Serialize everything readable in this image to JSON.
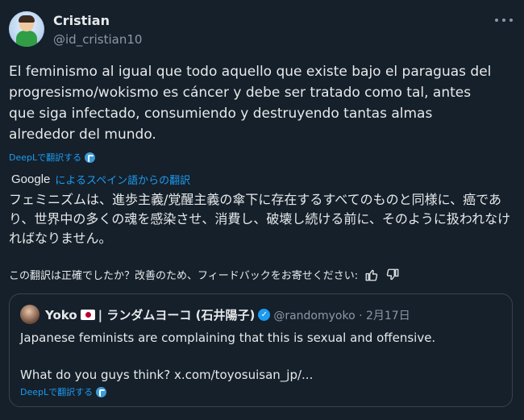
{
  "author": {
    "display_name": "Cristian",
    "handle": "@id_cristian10"
  },
  "tweet": {
    "text": "El feminismo al igual que todo aquello que existe bajo el paraguas del progresismo/wokismo es cáncer y debe ser tratado como tal, antes que siga infectado, consumiendo y destruyendo tantas almas alrededor del mundo.",
    "deepl_label": "DeepLで翻訳する"
  },
  "translation": {
    "brand": "Google",
    "source_label": "によるスペイン語からの翻訳",
    "text": "フェミニズムは、進歩主義/覚醒主義の傘下に存在するすべてのものと同様に、癌であり、世界中の多くの魂を感染させ、消費し、破壊し続ける前に、そのように扱われなければなりません。",
    "feedback_prompt": "この翻訳は正確でしたか？改善のため、フィードバックをお寄せください:"
  },
  "quote": {
    "display_name": "Yoko",
    "display_name_rest": "| ランダムヨーコ (石井陽子)",
    "handle_date": "@randomyoko · 2月17日",
    "line1": "Japanese feminists are complaining that this is sexual and offensive.",
    "line2": "What do you guys think? x.com/toyosuisan_jp/...",
    "deepl_label": "DeepLで翻訳する"
  },
  "icons": {
    "more": "more-icon",
    "thumbs_up": "thumbs-up-icon",
    "thumbs_down": "thumbs-down-icon",
    "deepl": "deepl-icon",
    "verified": "verified-badge-icon",
    "flag": "japan-flag-icon"
  },
  "colors": {
    "background": "#15202b",
    "link": "#1d9bf0",
    "muted": "#8b98a5",
    "border": "#38444d"
  }
}
